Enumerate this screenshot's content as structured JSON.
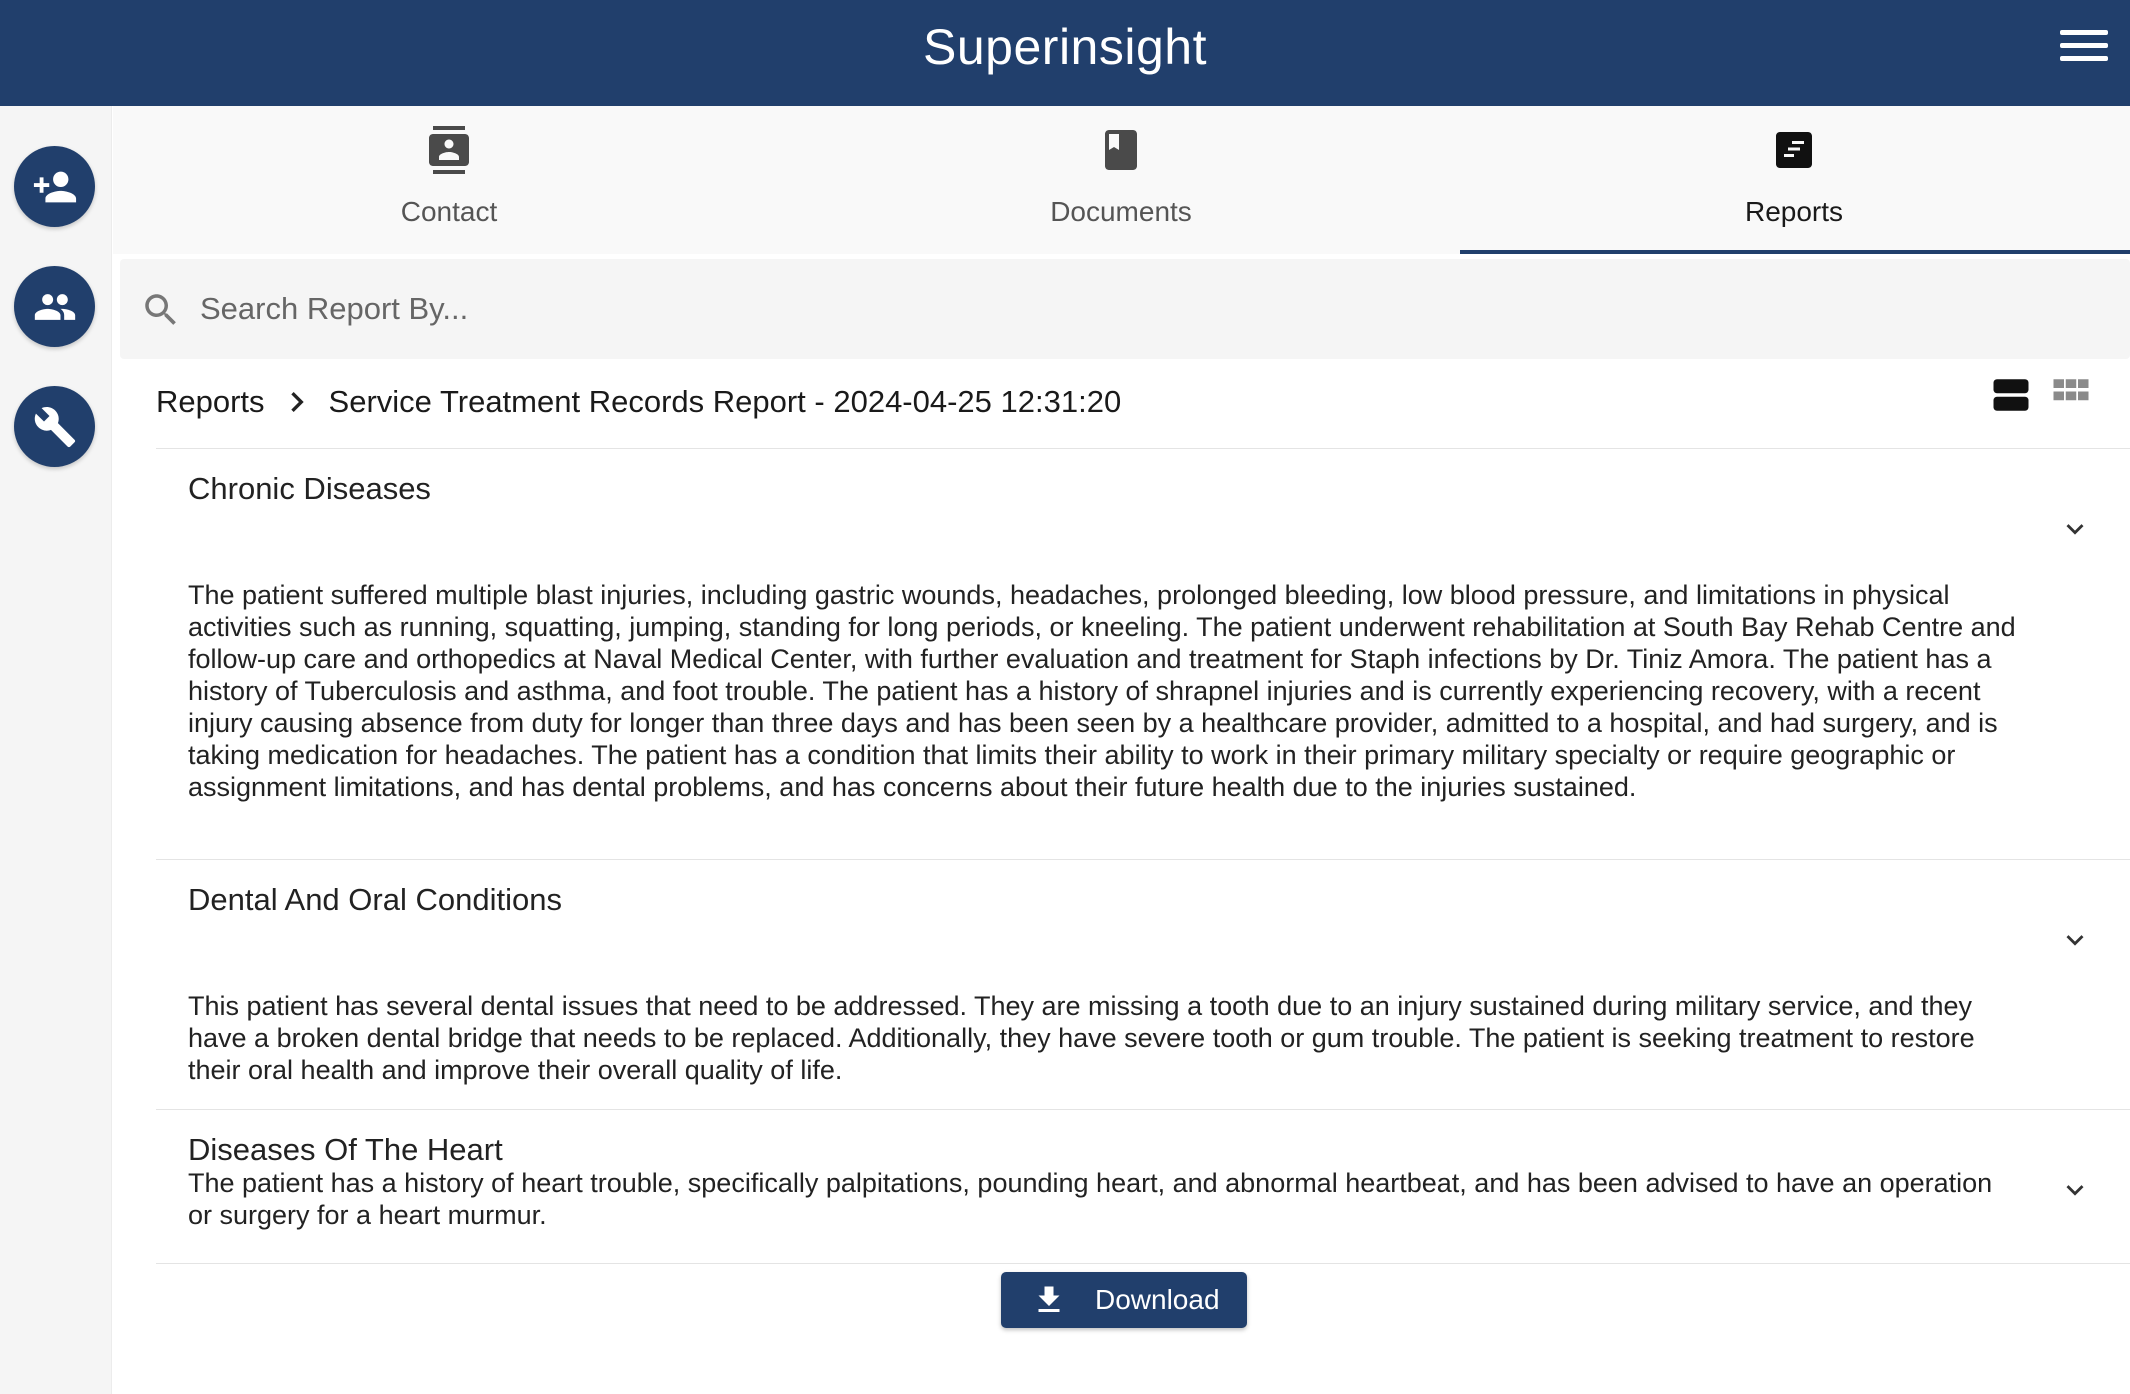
{
  "header": {
    "title": "Superinsight",
    "menu_icon": "hamburger-menu-icon"
  },
  "sidebar": {
    "items": [
      {
        "name": "add-contact",
        "icon": "person-add-icon"
      },
      {
        "name": "groups",
        "icon": "people-icon"
      },
      {
        "name": "tools",
        "icon": "wrench-icon"
      }
    ]
  },
  "tabs": [
    {
      "label": "Contact",
      "icon": "contact-card-icon",
      "active": false
    },
    {
      "label": "Documents",
      "icon": "book-icon",
      "active": false
    },
    {
      "label": "Reports",
      "icon": "report-icon",
      "active": true
    }
  ],
  "search": {
    "placeholder": "Search Report By...",
    "value": ""
  },
  "breadcrumb": {
    "root": "Reports",
    "current": "Service Treatment Records Report - 2024-04-25 12:31:20"
  },
  "view_toggle": {
    "options": [
      "list-view-icon",
      "grid-view-icon"
    ],
    "selected": "list-view-icon"
  },
  "sections": [
    {
      "title": "Chronic Diseases",
      "body": "The patient suffered multiple blast injuries, including gastric wounds, headaches, prolonged bleeding, low blood pressure, and limitations in physical activities such as running, squatting, jumping, standing for long periods, or kneeling. The patient underwent rehabilitation at South Bay Rehab Centre and follow-up care and orthopedics at Naval Medical Center, with further evaluation and treatment for Staph infections by Dr. Tiniz Amora. The patient has a history of Tuberculosis and asthma, and foot trouble. The patient has a history of shrapnel injuries and is currently experiencing recovery, with a recent injury causing absence from duty for longer than three days and has been seen by a healthcare provider, admitted to a hospital, and had surgery, and is taking medication for headaches. The patient has a condition that limits their ability to work in their primary military specialty or require geographic or assignment limitations, and has dental problems, and has concerns about their future health due to the injuries sustained."
    },
    {
      "title": "Dental And Oral Conditions",
      "body": "This patient has several dental issues that need to be addressed. They are missing a tooth due to an injury sustained during military service, and they have a broken dental bridge that needs to be replaced. Additionally, they have severe tooth or gum trouble. The patient is seeking treatment to restore their oral health and improve their overall quality of life."
    },
    {
      "title": "Diseases Of The Heart",
      "body": "The patient has a history of heart trouble, specifically palpitations, pounding heart, and abnormal heartbeat, and has been advised to have an operation or surgery for a heart murmur."
    }
  ],
  "download": {
    "label": "Download",
    "icon": "download-icon"
  },
  "colors": {
    "primary": "#213f6c",
    "background": "#ffffff",
    "panel": "#f5f5f5"
  }
}
